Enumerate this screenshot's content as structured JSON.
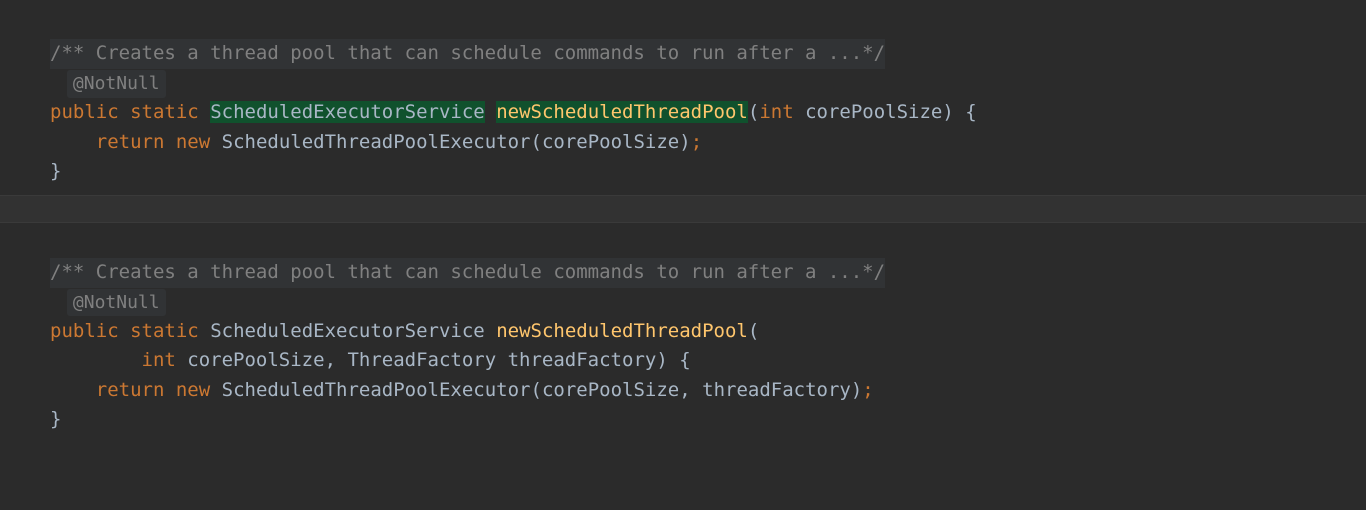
{
  "block1": {
    "docComment": "/** Creates a thread pool that can schedule commands to run after a ...*/",
    "annotation": "@NotNull",
    "k_public": "public",
    "k_static": "static",
    "returnType": "ScheduledExecutorService",
    "methodName": "newScheduledThreadPool",
    "lparen": "(",
    "paramType": "int",
    "paramName": " corePoolSize",
    "rparenBrace": ") {",
    "k_return": "return",
    "k_new": "new",
    "ctor": "ScheduledThreadPoolExecutor",
    "argOpen": "(",
    "arg": "corePoolSize",
    "argClose": ")",
    "semicolon": ";",
    "closeBrace": "}"
  },
  "block2": {
    "docComment": "/** Creates a thread pool that can schedule commands to run after a ...*/",
    "annotation": "@NotNull",
    "k_public": "public",
    "k_static": "static",
    "returnType": "ScheduledExecutorService",
    "methodName": "newScheduledThreadPool",
    "lparen": "(",
    "param1Type": "int",
    "param1Name": " corePoolSize",
    "comma1": ", ",
    "param2Type": "ThreadFactory",
    "param2Name": " threadFactory",
    "rparenBrace": ") {",
    "k_return": "return",
    "k_new": "new",
    "ctor": "ScheduledThreadPoolExecutor",
    "argOpen": "(",
    "arg1": "corePoolSize",
    "commaArg": ", ",
    "arg2": "threadFactory",
    "argClose": ")",
    "semicolon": ";",
    "closeBrace": "}"
  }
}
